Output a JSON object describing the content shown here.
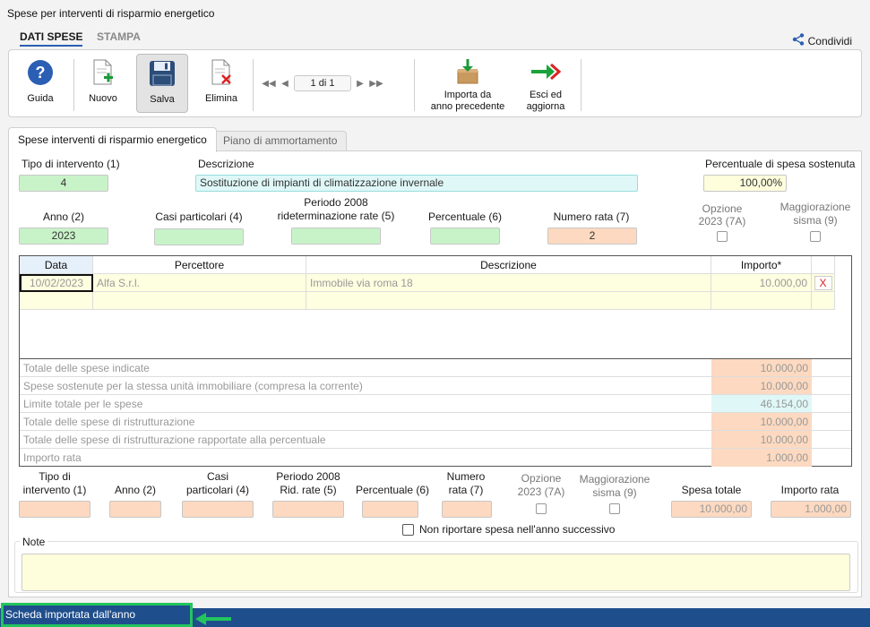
{
  "window": {
    "title": "Spese per interventi di risparmio energetico"
  },
  "top_tabs": [
    {
      "label": "DATI SPESE"
    },
    {
      "label": "STAMPA"
    }
  ],
  "share": {
    "label": "Condividi"
  },
  "toolbar": {
    "guida": "Guida",
    "nuovo": "Nuovo",
    "salva": "Salva",
    "elimina": "Elimina",
    "pager": "1 di 1",
    "importa_1": "Importa da",
    "importa_2": "anno precedente",
    "esci_1": "Esci ed",
    "esci_2": "aggiorna"
  },
  "tabs": [
    {
      "label": "Spese interventi di risparmio energetico"
    },
    {
      "label": "Piano di ammortamento"
    }
  ],
  "form": {
    "tipo_label": "Tipo di intervento (1)",
    "tipo_value": "4",
    "descr_label": "Descrizione",
    "descr_value": "Sostituzione di impianti di climatizzazione invernale",
    "perc_spesa_label": "Percentuale di spesa sostenuta",
    "perc_spesa_value": "100,00%",
    "anno_label": "Anno (2)",
    "anno_value": "2023",
    "casi_label": "Casi particolari (4)",
    "casi_value": "",
    "periodo_label_1": "Periodo 2008",
    "periodo_label_2": "rideterminazione rate (5)",
    "periodo_value": "",
    "percentuale_label": "Percentuale (6)",
    "percentuale_value": "",
    "numero_rata_label": "Numero rata (7)",
    "numero_rata_value": "2",
    "opzione_label_1": "Opzione",
    "opzione_label_2": "2023 (7A)",
    "maggiorazione_label_1": "Maggiorazione",
    "maggiorazione_label_2": "sisma (9)"
  },
  "grid": {
    "headers": {
      "data": "Data",
      "percettore": "Percettore",
      "descrizione": "Descrizione",
      "importo": "Importo*"
    },
    "rows": [
      {
        "data": "10/02/2023",
        "percettore": "Alfa S.r.l.",
        "descrizione": "Immobile via roma 18",
        "importo": "10.000,00",
        "delete": "X"
      },
      {
        "data": "",
        "percettore": "",
        "descrizione": "",
        "importo": "",
        "delete": ""
      }
    ],
    "summary": [
      {
        "label": "Totale delle spese indicate",
        "value": "10.000,00"
      },
      {
        "label": "Spese sostenute per la stessa unità immobiliare (compresa la corrente)",
        "value": "10.000,00"
      },
      {
        "label": "Limite totale per le spese",
        "value": "46.154,00"
      },
      {
        "label": "Totale delle spese di ristrutturazione",
        "value": "10.000,00"
      },
      {
        "label": "Totale delle spese di ristrutturazione rapportate alla percentuale",
        "value": "10.000,00"
      },
      {
        "label": "Importo rata",
        "value": "1.000,00"
      }
    ]
  },
  "bottom": {
    "tipo_1": "Tipo di",
    "tipo_2": "intervento (1)",
    "anno": "Anno (2)",
    "casi_1": "Casi",
    "casi_2": "particolari (4)",
    "periodo_1": "Periodo 2008",
    "periodo_2": "Rid. rate (5)",
    "percentuale": "Percentuale (6)",
    "numero_1": "Numero",
    "numero_2": "rata (7)",
    "opzione_1": "Opzione",
    "opzione_2": "2023 (7A)",
    "magg_1": "Maggiorazione",
    "magg_2": "sisma (9)",
    "spesa_totale": "Spesa totale",
    "spesa_totale_value": "10.000,00",
    "importo_rata": "Importo rata",
    "importo_rata_value": "1.000,00",
    "non_riportare": "Non riportare spesa nell'anno successivo",
    "note_label": "Note"
  },
  "status": {
    "text": "Scheda importata dall'anno precedente"
  },
  "colors": {
    "status_bar": "#1f4e8c",
    "highlight": "#22c55e",
    "accent_blue": "#2b5fb3"
  }
}
